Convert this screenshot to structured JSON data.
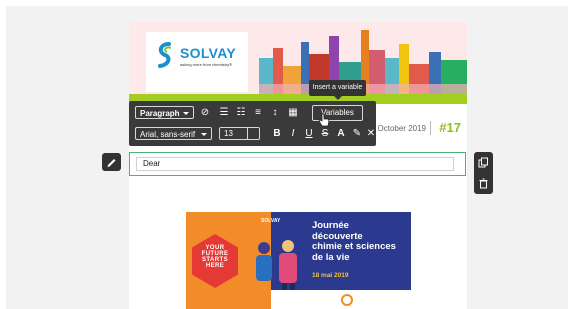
{
  "header": {
    "brand_name": "SOLVAY",
    "tagline": "asking more from chemistry®",
    "date": "October 2019",
    "issue": "#17",
    "colors": {
      "brand_blue": "#1b8fd0",
      "green": "#a3cd21",
      "issue_green": "#8fbf1c"
    }
  },
  "tooltip": {
    "text": "Insert a variable"
  },
  "toolbar": {
    "block_format": "Paragraph",
    "font_family": "Arial, sans-serif",
    "font_size": "13",
    "variables_label": "Variables",
    "icons": [
      "clear-format-icon",
      "bullet-list-icon",
      "numbered-list-icon",
      "align-icon",
      "line-height-icon",
      "columns-icon",
      "bold-icon",
      "italic-icon",
      "underline-icon",
      "strikethrough-icon",
      "font-color-icon",
      "highlight-icon",
      "remove-format-icon"
    ]
  },
  "editor": {
    "text": "Dear"
  },
  "event": {
    "logo": "SOLVAY",
    "title_lines": [
      "Journée",
      "découverte",
      "chimie et sciences",
      "de la vie"
    ],
    "date": "18 mai 2019",
    "hex_lines": [
      "YOUR",
      "FUTURE",
      "STARTS",
      "HERE"
    ]
  }
}
